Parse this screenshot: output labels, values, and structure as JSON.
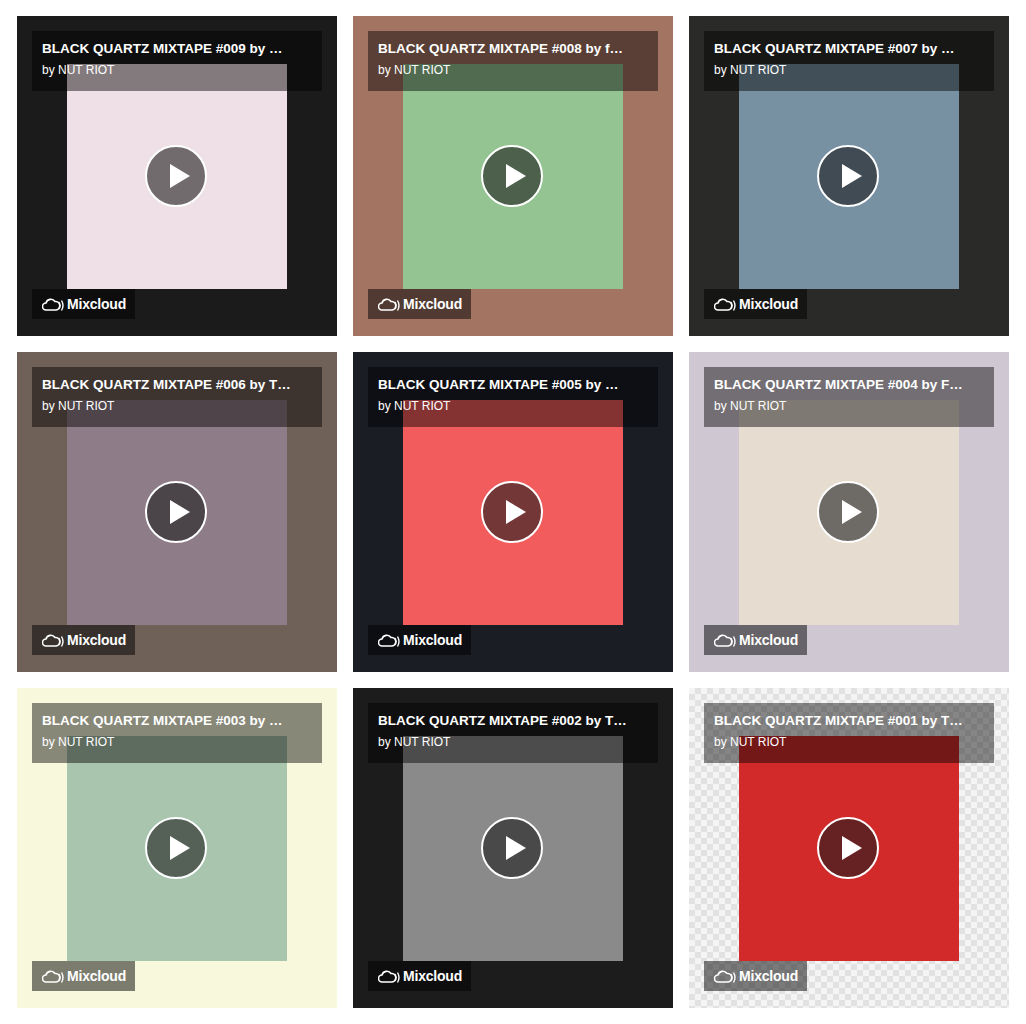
{
  "cards": [
    {
      "title": "BLACK QUARTZ MIXTAPE #009 by …",
      "artist": "by NUT RIOT",
      "badge": "Mixcloud",
      "color": "#efdfe6"
    },
    {
      "title": "BLACK QUARTZ MIXTAPE #008 by f…",
      "artist": "by NUT RIOT",
      "badge": "Mixcloud",
      "color": "#94c492"
    },
    {
      "title": "BLACK QUARTZ MIXTAPE #007 by …",
      "artist": "by NUT RIOT",
      "badge": "Mixcloud",
      "color": "#7790a2"
    },
    {
      "title": "BLACK QUARTZ MIXTAPE #006 by T…",
      "artist": "by NUT RIOT",
      "badge": "Mixcloud",
      "color": "#8e7d88"
    },
    {
      "title": "BLACK QUARTZ MIXTAPE #005 by …",
      "artist": "by NUT RIOT",
      "badge": "Mixcloud",
      "color": "#f25c5c"
    },
    {
      "title": "BLACK QUARTZ MIXTAPE #004 by F…",
      "artist": "by NUT RIOT",
      "badge": "Mixcloud",
      "color": "#e6dccf"
    },
    {
      "title": "BLACK QUARTZ MIXTAPE #003 by …",
      "artist": "by NUT RIOT",
      "badge": "Mixcloud",
      "color": "#a9c5ad"
    },
    {
      "title": "BLACK QUARTZ MIXTAPE #002 by T…",
      "artist": "by NUT RIOT",
      "badge": "Mixcloud",
      "color": "#8a8a8a"
    },
    {
      "title": "BLACK QUARTZ MIXTAPE #001 by T…",
      "artist": "by NUT RIOT",
      "badge": "Mixcloud",
      "color": "#d22a2a"
    }
  ]
}
